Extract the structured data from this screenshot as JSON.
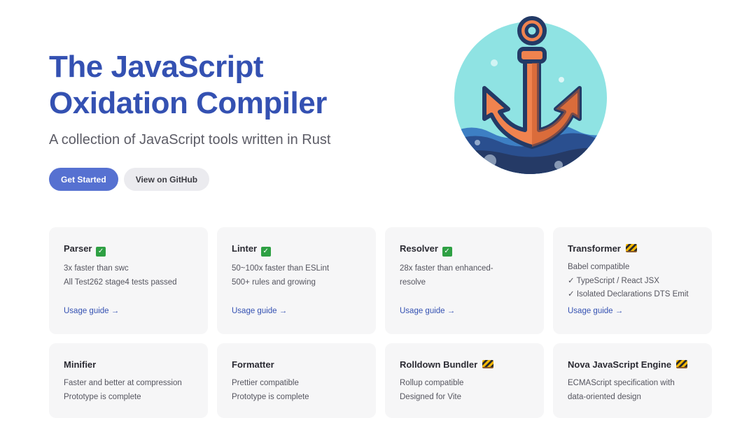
{
  "hero": {
    "title_line1": "The JavaScript",
    "title_line2": "Oxidation Compiler",
    "tagline": "A collection of JavaScript tools written in Rust",
    "primary_action": "Get Started",
    "secondary_action": "View on GitHub"
  },
  "colors": {
    "brand": "#3451b2",
    "primary_button": "#5671d1",
    "card_background": "#f6f6f7",
    "anchor_orange": "#f0834f",
    "logo_water": "#8fe3e3",
    "logo_sea": "#2a4f8f"
  },
  "logo": {
    "icon": "anchor-icon"
  },
  "features": [
    {
      "title": "Parser",
      "badge": "check-icon",
      "lines": [
        "3x faster than swc",
        "All Test262 stage4 tests passed"
      ],
      "link": "Usage guide →"
    },
    {
      "title": "Linter",
      "badge": "check-icon",
      "lines": [
        "50~100x faster than ESLint",
        "500+ rules and growing"
      ],
      "link": "Usage guide →"
    },
    {
      "title": "Resolver",
      "badge": "check-icon",
      "lines": [
        "28x faster than enhanced-",
        "resolve"
      ],
      "link": "Usage guide →"
    },
    {
      "title": "Transformer",
      "badge": "construction-icon",
      "lines": [
        "Babel compatible",
        "✓ TypeScript / React JSX",
        "✓ Isolated Declarations DTS Emit"
      ],
      "link": "Usage guide →"
    },
    {
      "title": "Minifier",
      "lines": [
        "Faster and better at compression",
        "Prototype is complete"
      ]
    },
    {
      "title": "Formatter",
      "lines": [
        "Prettier compatible",
        "Prototype is complete"
      ]
    },
    {
      "title": "Rolldown Bundler",
      "badge": "construction-icon",
      "lines": [
        "Rollup compatible",
        "Designed for Vite"
      ]
    },
    {
      "title": "Nova JavaScript Engine",
      "badge": "construction-icon",
      "lines": [
        "ECMAScript specification with",
        "data-oriented design"
      ]
    }
  ]
}
